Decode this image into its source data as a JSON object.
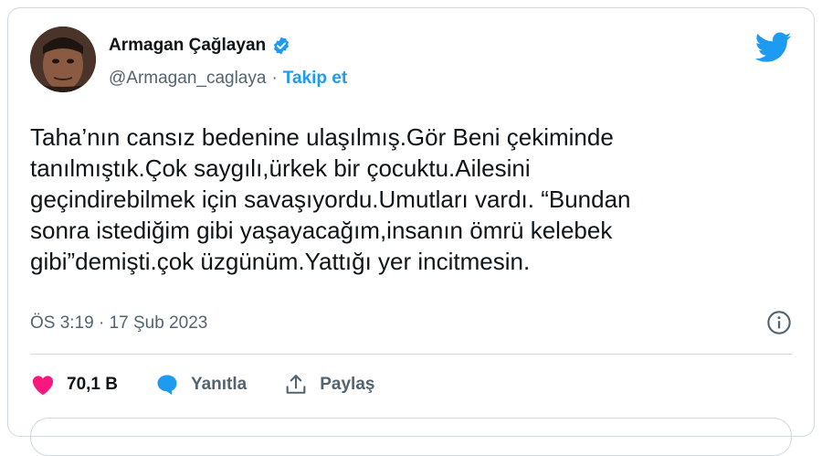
{
  "author": {
    "name": "Armagan Çağlayan",
    "handle": "@Armagan_caglaya",
    "separator": "·",
    "follow_label": "Takip et",
    "verified": true
  },
  "tweet": {
    "text": "Taha’nın cansız bedenine ulaşılmış.Gör Beni çekiminde\ntanılmıştık.Çok saygılı,ürkek bir çocuktu.Ailesini\ngeçindirebilmek için savaşıyordu.Umutları vardı. “Bundan\nsonra istediğim gibi yaşayacağım,insanın ömrü kelebek\ngibi”demişti.çok üzgünüm.Yattığı yer incitmesin.",
    "timestamp": "ÖS 3:19 · 17 Şub 2023"
  },
  "actions": {
    "likes": "70,1 B",
    "reply_label": "Yanıtla",
    "share_label": "Paylaş"
  },
  "colors": {
    "accent": "#1d9bf0",
    "like": "#f91880",
    "text": "#0f1419",
    "muted": "#536471",
    "border": "#cfd9de"
  },
  "icons": [
    "verified-badge-icon",
    "twitter-bird-icon",
    "info-icon",
    "heart-icon",
    "reply-bubble-icon",
    "share-icon"
  ]
}
